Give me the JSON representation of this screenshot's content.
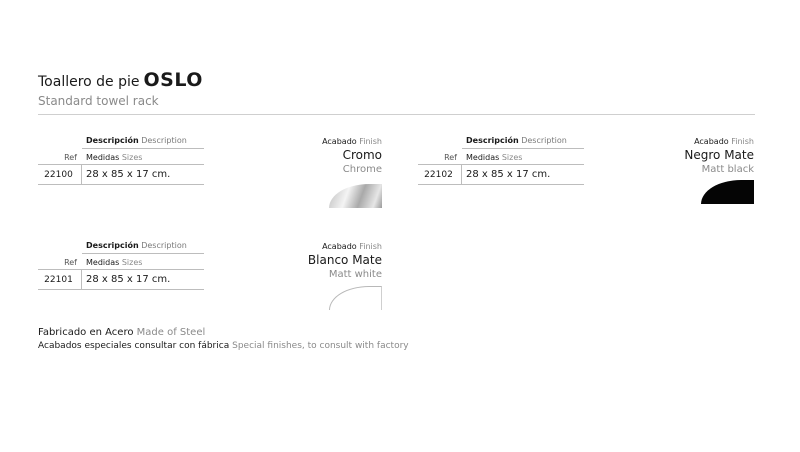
{
  "product": {
    "title_prefix": "Toallero de pie",
    "model": "OSLO",
    "subtitle": "Standard towel rack"
  },
  "labels": {
    "descripcion": "Descripción",
    "description": "Description",
    "ref": "Ref",
    "medidas": "Medidas",
    "sizes": "Sizes",
    "acabado": "Acabado",
    "finish": "Finish"
  },
  "items": [
    {
      "ref": "22100",
      "dims": "28 x 85 x 17 cm.",
      "finish_es": "Cromo",
      "finish_en": "Chrome",
      "swatch": "#c8c8c8"
    },
    {
      "ref": "22102",
      "dims": "28 x 85 x 17 cm.",
      "finish_es": "Negro Mate",
      "finish_en": "Matt black",
      "swatch": "#050505"
    },
    {
      "ref": "22101",
      "dims": "28 x 85 x 17 cm.",
      "finish_es": "Blanco Mate",
      "finish_en": "Matt white",
      "swatch": "#ffffff"
    }
  ],
  "footer": {
    "material_es": "Fabricado en Acero",
    "material_en": "Made of Steel",
    "special_es": "Acabados especiales consultar con fábrica",
    "special_en": "Special finishes, to consult with factory"
  }
}
